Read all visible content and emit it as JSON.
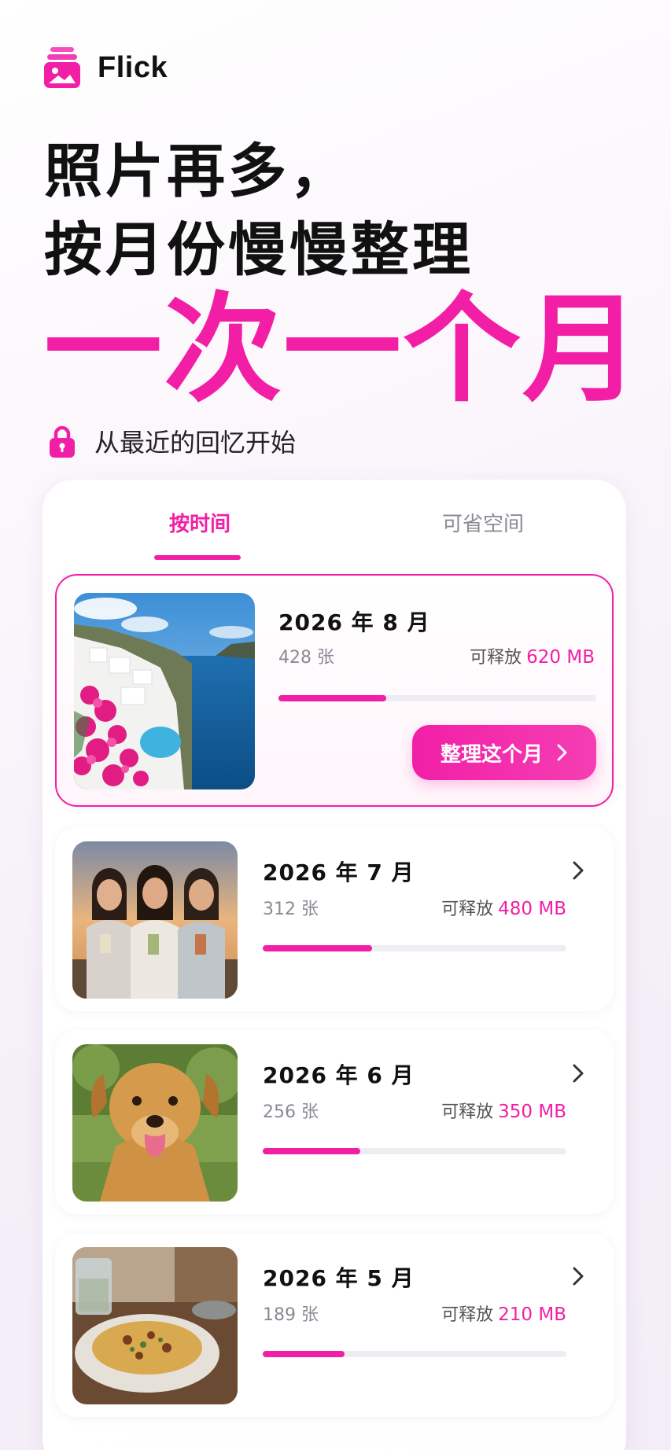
{
  "app": {
    "name": "Flick"
  },
  "headline": {
    "line1": "照片再多，",
    "line2": "按月份慢慢整理",
    "accent": "一次一个月"
  },
  "subtitle": "从最近的回忆开始",
  "tabs": [
    {
      "label": "按时间",
      "active": true
    },
    {
      "label": "可省空间",
      "active": false
    }
  ],
  "months": [
    {
      "title": "2026 年 8 月",
      "count": "428 张",
      "release_label": "可释放",
      "release_amount": "620 MB",
      "progress": 0.34,
      "photo": "cliffside-sea-flowers"
    },
    {
      "title": "2026 年 7 月",
      "count": "312 张",
      "release_label": "可释放",
      "release_amount": "480 MB",
      "progress": 0.36,
      "photo": "three-friends-drinks"
    },
    {
      "title": "2026 年 6 月",
      "count": "256 张",
      "release_label": "可释放",
      "release_amount": "350 MB",
      "progress": 0.32,
      "photo": "golden-retriever"
    },
    {
      "title": "2026 年 5 月",
      "count": "189 张",
      "release_label": "可释放",
      "release_amount": "210 MB",
      "progress": 0.27,
      "photo": "pasta-dish"
    }
  ],
  "cta": {
    "label": "整理这个月"
  },
  "colors": {
    "accent": "#f21fa6",
    "track": "#eeeef2"
  }
}
